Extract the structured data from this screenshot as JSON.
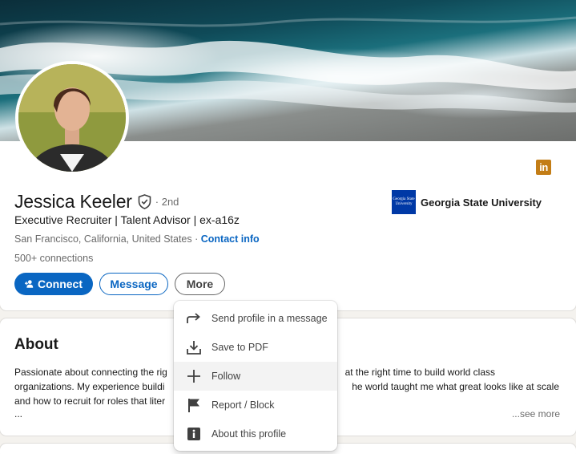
{
  "profile": {
    "name": "Jessica Keeler",
    "degree": "· 2nd",
    "headline": "Executive Recruiter | Talent Advisor | ex-a16z",
    "location": "San Francisco, California, United States",
    "location_separator": " · ",
    "contact_info": "Contact info",
    "connections": "500+ connections",
    "education": {
      "name": "Georgia State University",
      "logo_text": "Georgia State University"
    },
    "social_icon": "linkedin-icon"
  },
  "actions": {
    "connect": "Connect",
    "message": "Message",
    "more": "More"
  },
  "about": {
    "title": "About",
    "line1_left": "Passionate about connecting the rig",
    "line1_right": "at the right time to build world class",
    "line2_left": "organizations. My experience buildi",
    "line2_right": "he world taught me what great looks like at scale",
    "line3_left": "and how to recruit for roles that liter",
    "ellipsis": "...",
    "see_more": "...see more"
  },
  "more_menu": {
    "items": [
      {
        "label": "Send profile in a message",
        "icon": "share-arrow-icon"
      },
      {
        "label": "Save to PDF",
        "icon": "download-icon"
      },
      {
        "label": "Follow",
        "icon": "plus-icon"
      },
      {
        "label": "Report / Block",
        "icon": "flag-icon"
      },
      {
        "label": "About this profile",
        "icon": "info-icon"
      }
    ]
  },
  "colors": {
    "primary": "#0a66c2",
    "linkedin_badge": "#c37d16",
    "university_blue": "#0039a6"
  }
}
